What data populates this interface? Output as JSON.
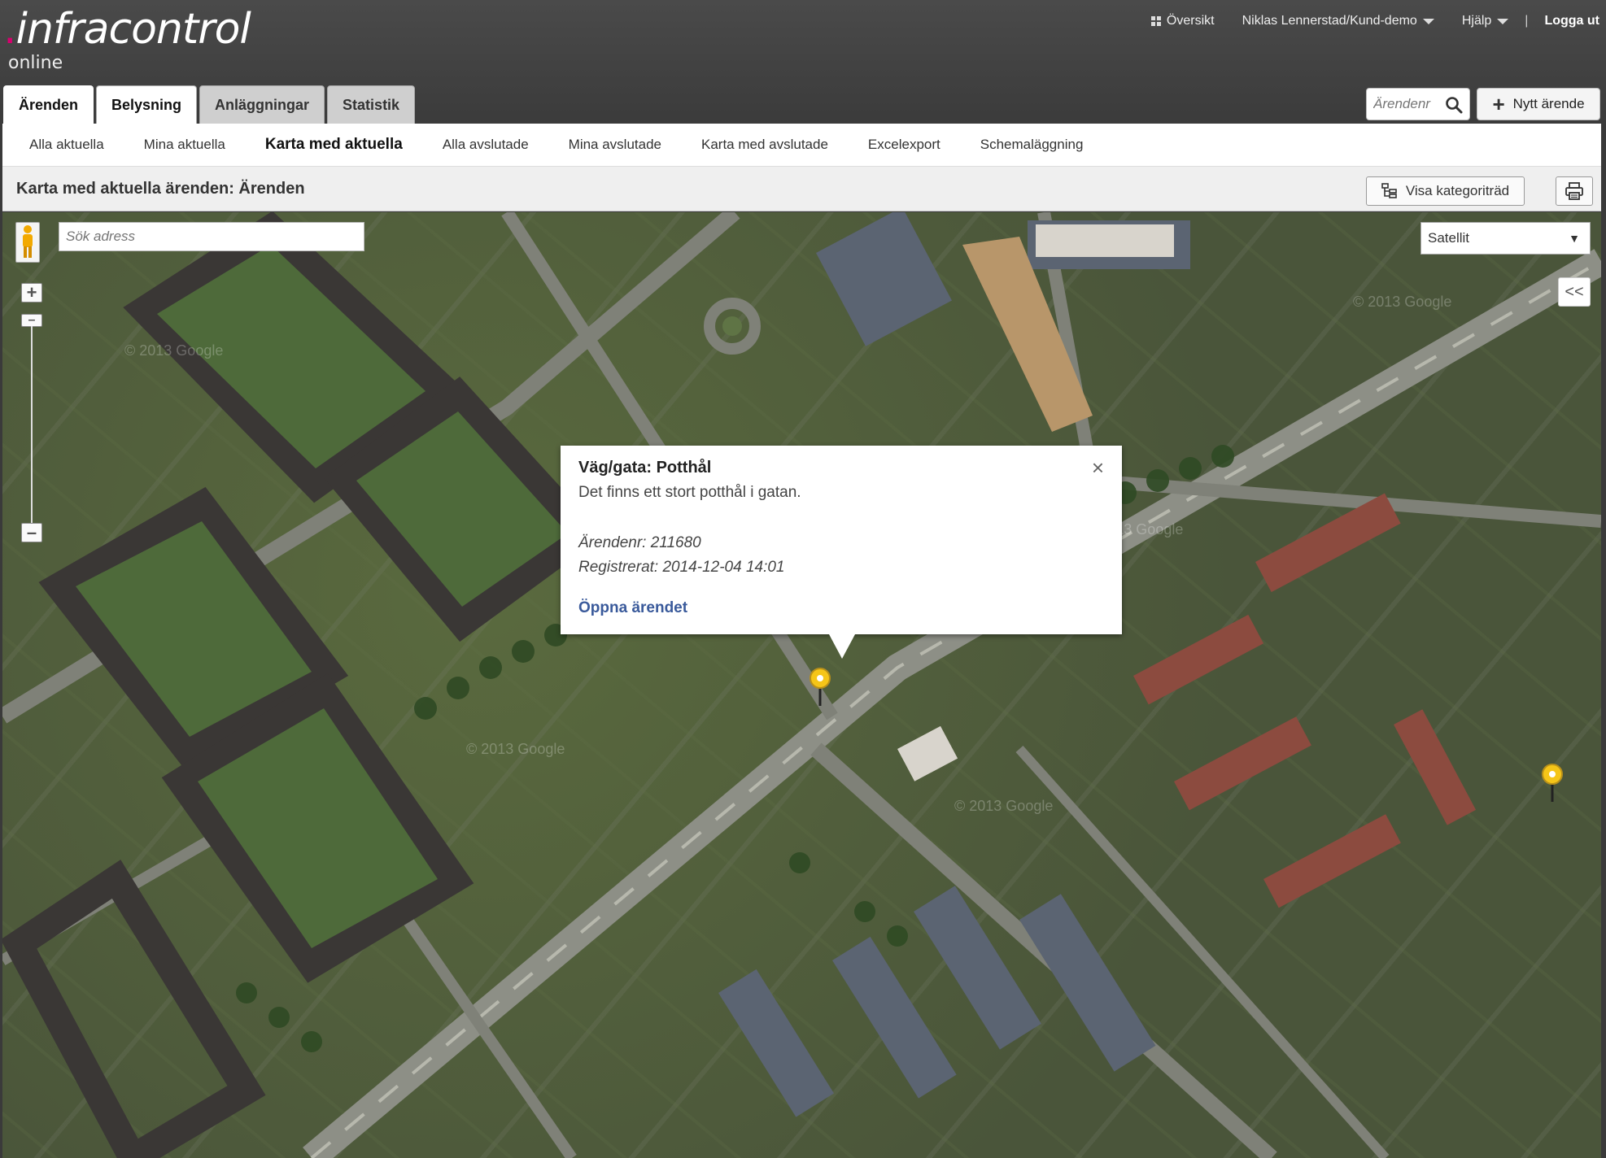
{
  "app": {
    "logo_text": "infracontrol",
    "logo_sub": "online"
  },
  "topnav": {
    "overview": "Översikt",
    "user": "Niklas Lennerstad/Kund-demo",
    "help": "Hjälp",
    "separator": "|",
    "logout": "Logga ut"
  },
  "tabs": [
    {
      "label": "Ärenden"
    },
    {
      "label": "Belysning"
    },
    {
      "label": "Anläggningar"
    },
    {
      "label": "Statistik"
    }
  ],
  "search": {
    "placeholder": "Ärendenr"
  },
  "new_case_label": "Nytt ärende",
  "subnav": [
    {
      "label": "Alla aktuella"
    },
    {
      "label": "Mina aktuella"
    },
    {
      "label": "Karta med aktuella"
    },
    {
      "label": "Alla avslutade"
    },
    {
      "label": "Mina avslutade"
    },
    {
      "label": "Karta med avslutade"
    },
    {
      "label": "Excelexport"
    },
    {
      "label": "Schemaläggning"
    }
  ],
  "page_title": "Karta med aktuella ärenden: Ärenden",
  "category_tree_label": "Visa kategoriträd",
  "map": {
    "address_placeholder": "Sök adress",
    "map_type": "Satellit",
    "collapse_label": "<<",
    "watermark": "© 2013 Google"
  },
  "infowindow": {
    "title": "Väg/gata: Potthål",
    "description": "Det finns ett stort potthål i gatan.",
    "case_number": "Ärendenr: 211680",
    "registered": "Registrerat: 2014-12-04 14:01",
    "link": "Öppna ärendet",
    "close": "×"
  },
  "colors": {
    "header_bg": "#3b3b3b",
    "link": "#3a5a9b",
    "marker": "#f5c518",
    "logo_accent": "#d6006e"
  }
}
